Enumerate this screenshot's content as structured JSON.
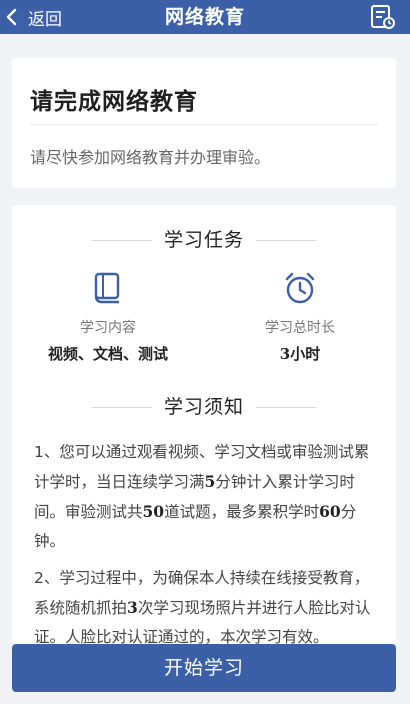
{
  "header": {
    "back_label": "返回",
    "title": "网络教育",
    "record_icon": "record-list-icon"
  },
  "intro": {
    "title": "请完成网络教育",
    "subtitle": "请尽快参加网络教育并办理审验。"
  },
  "task": {
    "heading": "学习任务",
    "content": {
      "icon": "book-icon",
      "label": "学习内容",
      "value": "视频、文档、测试"
    },
    "duration": {
      "icon": "alarm-clock-icon",
      "label": "学习总时长",
      "value": "3小时"
    }
  },
  "notice": {
    "heading": "学习须知",
    "p1": {
      "a": "1、您可以通过观看视频、学习文档或审验测试累计学时，当日连续学习满",
      "b": "5",
      "c": "分钟计入累计学习时间。审验测试共",
      "d": "50",
      "e": "道试题，最多累积学时",
      "f": "60",
      "g": "分钟。"
    },
    "p2": {
      "a": "2、学习过程中，为确保本人持续在线接受教育，系统随机抓拍",
      "b": "3",
      "c": "次学习现场照片并进行人脸比对认证。人脸比对认证通过的，本次学习有效。"
    }
  },
  "actions": {
    "start_label": "开始学习"
  },
  "colors": {
    "brand": "#3c60a8",
    "background": "#f1f3f6"
  }
}
